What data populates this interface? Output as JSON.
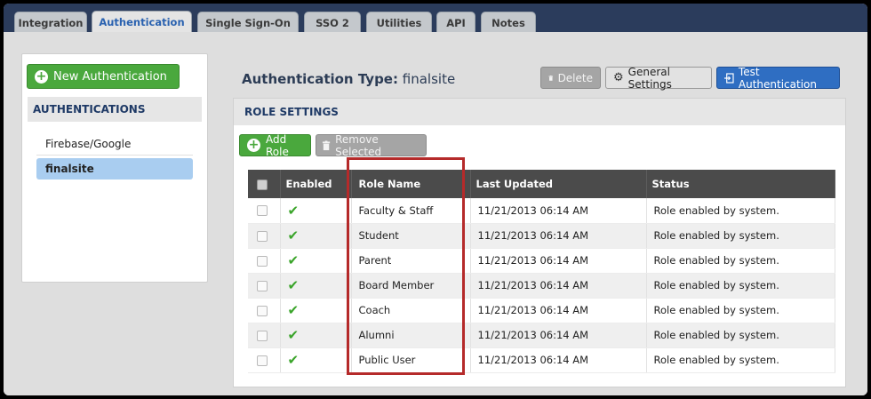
{
  "tabs": [
    {
      "label": "Integration",
      "active": false
    },
    {
      "label": "Authentication",
      "active": true
    },
    {
      "label": "Single Sign-On",
      "active": false
    },
    {
      "label": "SSO 2",
      "active": false
    },
    {
      "label": "Utilities",
      "active": false
    },
    {
      "label": "API",
      "active": false
    },
    {
      "label": "Notes",
      "active": false
    }
  ],
  "sidebar": {
    "new_button": "New Authentication",
    "heading": "AUTHENTICATIONS",
    "items": [
      {
        "label": "Firebase/Google",
        "selected": false
      },
      {
        "label": "finalsite",
        "selected": true
      }
    ]
  },
  "header": {
    "title_prefix": "Authentication Type:",
    "title_value": "finalsite",
    "delete_label": "Delete",
    "general_settings_label": "General Settings",
    "test_label": "Test Authentication"
  },
  "role_settings": {
    "heading": "ROLE SETTINGS",
    "add_label": "Add Role",
    "remove_label": "Remove Selected",
    "columns": [
      "Enabled",
      "Role Name",
      "Last Updated",
      "Status"
    ],
    "rows": [
      {
        "role": "Faculty & Staff",
        "updated": "11/21/2013 06:14 AM",
        "status": "Role enabled by system."
      },
      {
        "role": "Student",
        "updated": "11/21/2013 06:14 AM",
        "status": "Role enabled by system."
      },
      {
        "role": "Parent",
        "updated": "11/21/2013 06:14 AM",
        "status": "Role enabled by system."
      },
      {
        "role": "Board Member",
        "updated": "11/21/2013 06:14 AM",
        "status": "Role enabled by system."
      },
      {
        "role": "Coach",
        "updated": "11/21/2013 06:14 AM",
        "status": "Role enabled by system."
      },
      {
        "role": "Alumni",
        "updated": "11/21/2013 06:14 AM",
        "status": "Role enabled by system."
      },
      {
        "role": "Public User",
        "updated": "11/21/2013 06:14 AM",
        "status": "Role enabled by system."
      }
    ]
  },
  "icons": {
    "enabled_check": "checkmark-icon",
    "delete": "trash-icon",
    "settings": "gear-icon",
    "test": "login-icon",
    "add": "plus-circle-icon"
  },
  "colors": {
    "tabbar": "#2b3c5c",
    "accent_blue": "#2f6ec2",
    "green": "#4aa83d",
    "highlight": "#b52a2a"
  }
}
